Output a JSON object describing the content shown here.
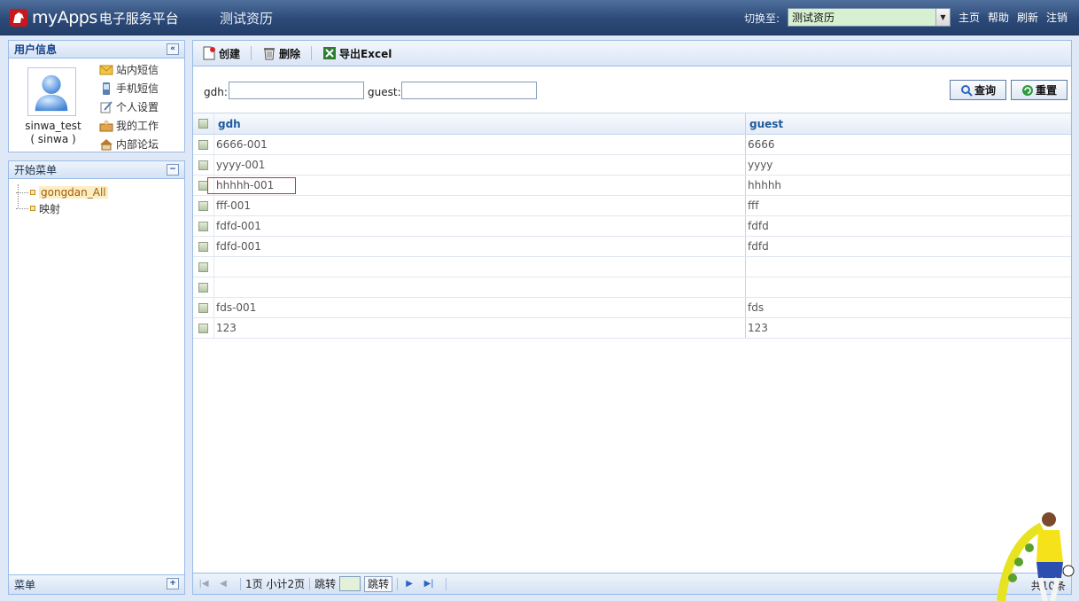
{
  "topbar": {
    "brand": "myApps",
    "brand_cn": "电子服务平台",
    "app_title": "测试资历",
    "switch_label": "切换至:",
    "switch_value": "测试资历",
    "links": [
      "主页",
      "帮助",
      "刷新",
      "注销"
    ]
  },
  "user_panel": {
    "title": "用户信息",
    "name": "sinwa_test",
    "id": "( sinwa )",
    "links": [
      {
        "label": "站内短信",
        "icon": "mail-icon"
      },
      {
        "label": "手机短信",
        "icon": "mobile-icon"
      },
      {
        "label": "个人设置",
        "icon": "edit-icon"
      },
      {
        "label": "我的工作",
        "icon": "work-icon"
      },
      {
        "label": "内部论坛",
        "icon": "home-icon"
      }
    ]
  },
  "menu_panel": {
    "title": "开始菜单",
    "items": [
      {
        "label": "gongdan_All",
        "selected": true
      },
      {
        "label": "映射",
        "selected": false
      }
    ],
    "footer": "菜单"
  },
  "toolbar": {
    "create": "创建",
    "delete": "删除",
    "export": "导出Excel"
  },
  "search": {
    "gdh_label": "gdh:",
    "guest_label": "guest:",
    "gdh_value": "",
    "guest_value": "",
    "query": "查询",
    "reset": "重置"
  },
  "grid": {
    "columns": [
      "gdh",
      "guest"
    ],
    "rows": [
      {
        "gdh": "6666-001",
        "guest": "6666"
      },
      {
        "gdh": "yyyy-001",
        "guest": "yyyy"
      },
      {
        "gdh": "hhhhh-001",
        "guest": "hhhhh"
      },
      {
        "gdh": "fff-001",
        "guest": "fff"
      },
      {
        "gdh": "fdfd-001",
        "guest": "fdfd"
      },
      {
        "gdh": "fdfd-001",
        "guest": "fdfd"
      },
      {
        "gdh": "",
        "guest": ""
      },
      {
        "gdh": "",
        "guest": ""
      },
      {
        "gdh": "fds-001",
        "guest": "fds"
      },
      {
        "gdh": "123",
        "guest": "123"
      }
    ],
    "highlighted_row": 2
  },
  "pager": {
    "page_info": "1页 小计2页",
    "jump_label": "跳转",
    "jump_button": "跳转",
    "jump_value": "",
    "right_text": "共10条"
  },
  "colors": {
    "topbar": "#2c4a78",
    "panel_border": "#99bbe8",
    "header_text": "#15428b",
    "highlight_box": "#c83232"
  }
}
